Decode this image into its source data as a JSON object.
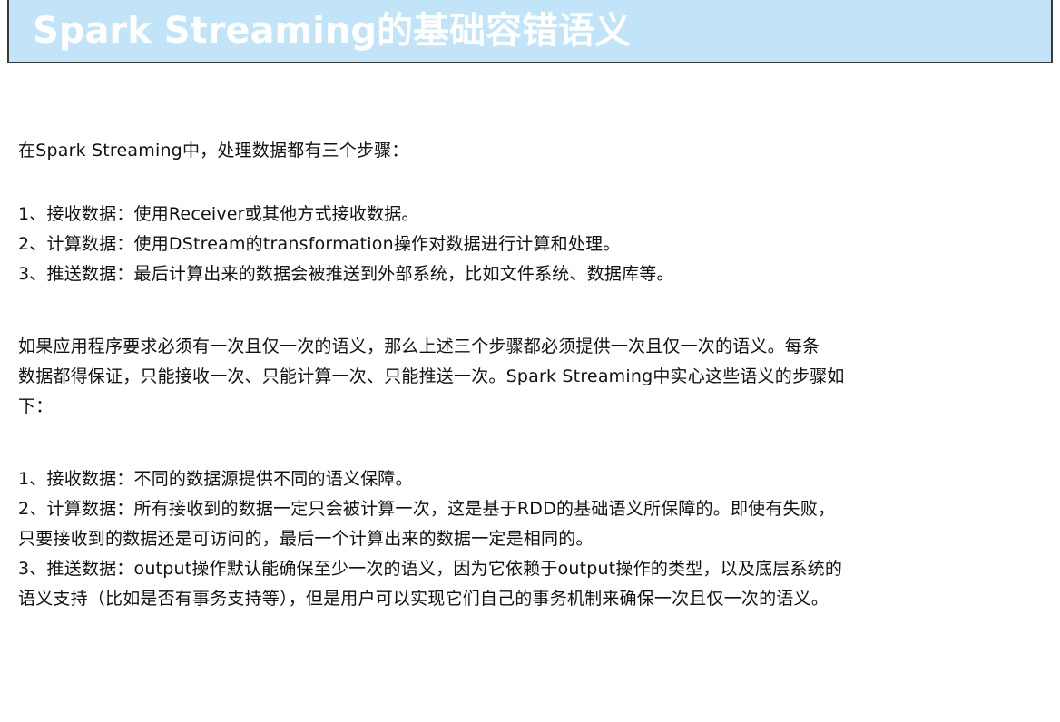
{
  "header": {
    "title": "Spark Streaming的基础容错语义"
  },
  "intro": "在Spark Streaming中，处理数据都有三个步骤：",
  "steps": [
    "1、接收数据：使用Receiver或其他方式接收数据。",
    "2、计算数据：使用DStream的transformation操作对数据进行计算和处理。",
    "3、推送数据：最后计算出来的数据会被推送到外部系统，比如文件系统、数据库等。"
  ],
  "paragraph": [
    "如果应用程序要求必须有一次且仅一次的语义，那么上述三个步骤都必须提供一次且仅一次的语义。每条",
    "数据都得保证，只能接收一次、只能计算一次、只能推送一次。Spark Streaming中实心这些语义的步骤如",
    "下："
  ],
  "details": [
    "1、接收数据：不同的数据源提供不同的语义保障。",
    "2、计算数据：所有接收到的数据一定只会被计算一次，这是基于RDD的基础语义所保障的。即使有失败，",
    "只要接收到的数据还是可访问的，最后一个计算出来的数据一定是相同的。",
    "3、推送数据：output操作默认能确保至少一次的语义，因为它依赖于output操作的类型，以及底层系统的",
    "语义支持（比如是否有事务支持等），但是用户可以实现它们自己的事务机制来确保一次且仅一次的语义。"
  ],
  "colors": {
    "title_bg": "#c2e4f8",
    "title_text": "#ffffff",
    "body_text": "#111111"
  }
}
